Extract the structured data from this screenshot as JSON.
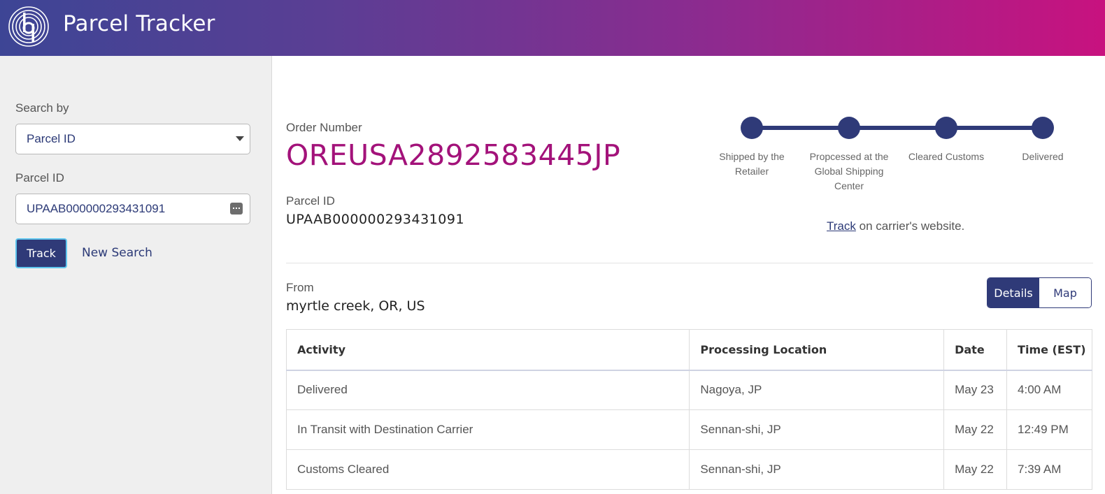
{
  "header": {
    "app_title": "Parcel Tracker",
    "logo_icon": "pitney-bowes-logo-icon",
    "gradient_start": "#3d4595",
    "gradient_end": "#c8127f"
  },
  "sidebar": {
    "search_by_label": "Search by",
    "search_by_value": "Parcel ID",
    "parcel_id_label": "Parcel ID",
    "parcel_id_value": "UPAAB000000293431091",
    "track_button": "Track",
    "new_search_link": "New Search"
  },
  "summary": {
    "order_number_label": "Order Number",
    "order_number": "OREUSA2892583445JP",
    "parcel_id_label": "Parcel ID",
    "parcel_id": "UPAAB000000293431091"
  },
  "progress": {
    "steps": [
      {
        "label": "Shipped by the Retailer",
        "complete": true
      },
      {
        "label": "Propcessed at the Global Shipping Center",
        "complete": true
      },
      {
        "label": "Cleared Customs",
        "complete": true
      },
      {
        "label": "Delivered",
        "complete": true
      }
    ]
  },
  "carrier": {
    "track_link": "Track",
    "suffix": "on carrier's website."
  },
  "origin": {
    "from_label": "From",
    "from_value": "myrtle creek, OR, US"
  },
  "view_toggle": {
    "details": "Details",
    "map": "Map",
    "active": "Details"
  },
  "activity_table": {
    "headers": [
      "Activity",
      "Processing Location",
      "Date",
      "Time (EST)"
    ],
    "rows": [
      [
        "Delivered",
        "Nagoya, JP",
        "May 23",
        "4:00 AM"
      ],
      [
        "In Transit with Destination Carrier",
        "Sennan-shi, JP",
        "May 22",
        "12:49 PM"
      ],
      [
        "Customs Cleared",
        "Sennan-shi, JP",
        "May 22",
        "7:39 AM"
      ]
    ]
  },
  "colors": {
    "brand_navy": "#2f3a78",
    "order_magenta": "#a3127a"
  }
}
